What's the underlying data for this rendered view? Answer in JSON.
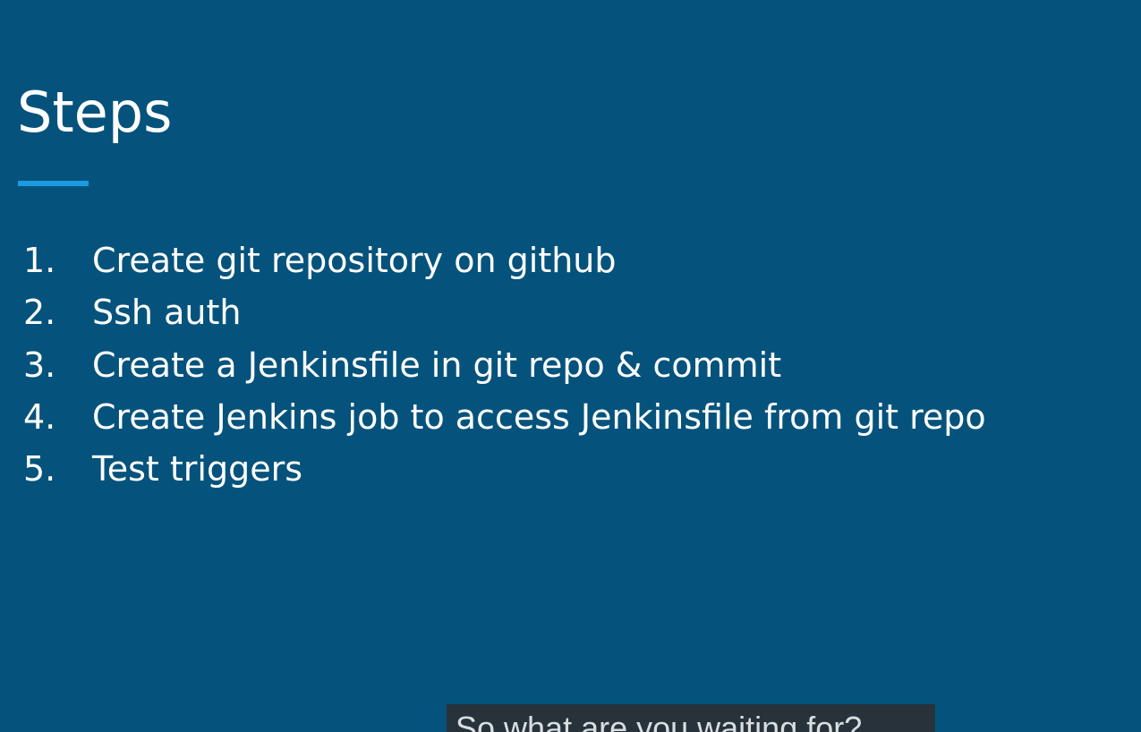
{
  "slide": {
    "title": "Steps",
    "steps": [
      {
        "number": "1.",
        "text": "Create git repository on github"
      },
      {
        "number": "2.",
        "text": "Ssh auth"
      },
      {
        "number": "3.",
        "text": "Create a Jenkinsfile in git repo & commit"
      },
      {
        "number": "4.",
        "text": "Create Jenkins job to access Jenkinsfile from git repo"
      },
      {
        "number": "5.",
        "text": "Test triggers"
      }
    ]
  },
  "caption": {
    "text": "So what are you waiting for?"
  },
  "colors": {
    "background": "#05537c",
    "accent": "#1a9ae0",
    "text": "#ffffff",
    "caption_background": "#27323a"
  }
}
